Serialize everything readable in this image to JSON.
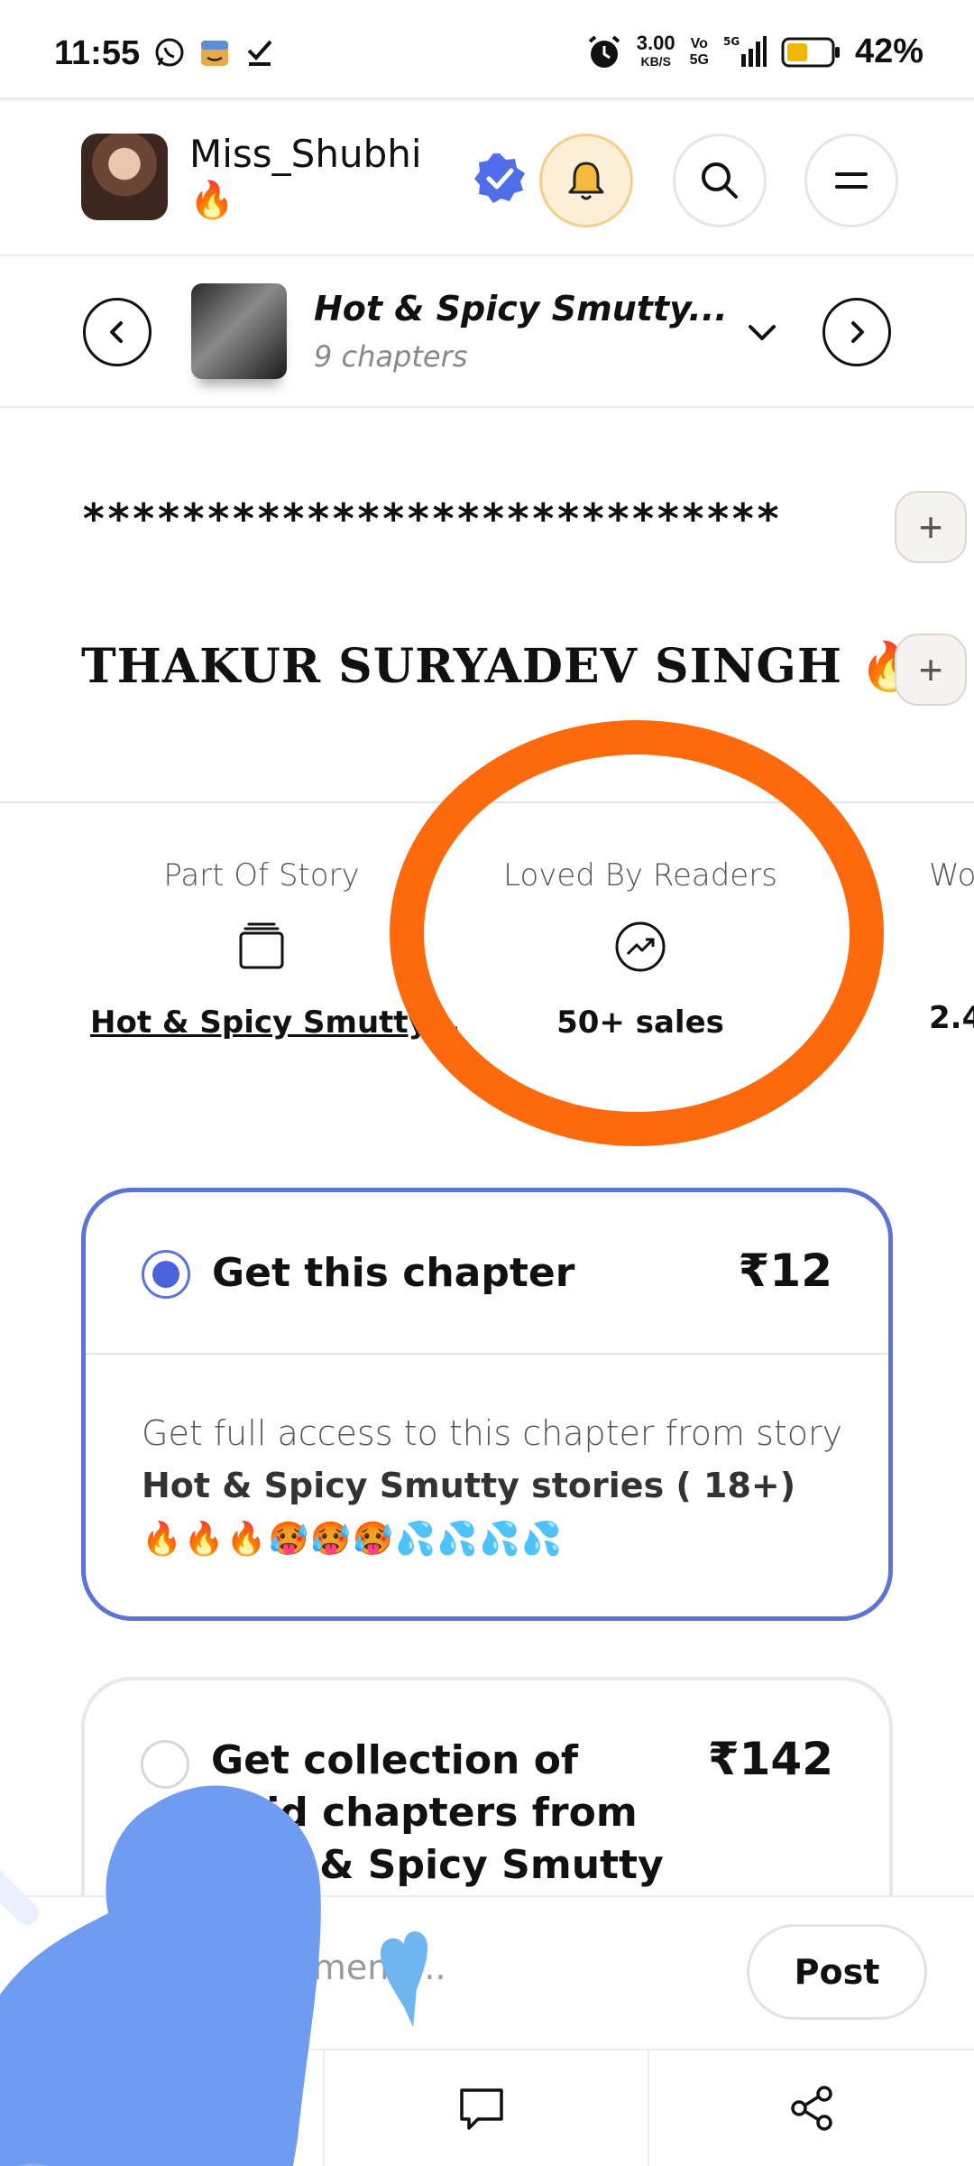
{
  "status_bar": {
    "time": "11:55",
    "net_speed": "3.00",
    "net_unit": "KB/S",
    "volte_top": "Vo",
    "volte_bottom": "5G",
    "network": "5G",
    "battery": "42%",
    "notification_icons": [
      "whatsapp-icon",
      "amazon-icon",
      "check-icon"
    ]
  },
  "header": {
    "username": "Miss_Shubhi",
    "user_badge": "🔥",
    "icons": [
      "verified-icon",
      "bell-icon",
      "search-icon",
      "menu-icon"
    ],
    "bell_bg_color": "#fcefd8",
    "verified_color": "#4f6ee8"
  },
  "story_nav": {
    "title": "Hot & Spicy Smutty...",
    "subtitle": "9 chapters"
  },
  "content": {
    "stars_line": "****************************",
    "heading": "THAKUR SURYADEV SINGH 🔥",
    "plus_label": "+"
  },
  "stats": [
    {
      "label": "Part Of Story",
      "value": "Hot & Spicy Smutty...",
      "icon": "stack-icon"
    },
    {
      "label": "Loved By Readers",
      "value": "50+ sales",
      "icon": "trending-icon"
    },
    {
      "label": "Wo",
      "value": "2.4",
      "icon": "none"
    }
  ],
  "annotation_color": "#fd6a0e",
  "options": {
    "chapter": {
      "title": "Get this chapter",
      "price": "₹12",
      "desc_prefix": "Get full access to this chapter from story ",
      "desc_bold": "Hot & Spicy Smutty stories ( 18+)",
      "emojis": "🔥🔥🔥🥵🥵🥵💦💦💦💦",
      "accent": "#5b74d8"
    },
    "collection": {
      "title": "Get collection of paid chapters from ‘Hot & Spicy Smutty stories ...",
      "price": "₹142"
    }
  },
  "comment": {
    "placeholder": "Comment ...",
    "post_label": "Post"
  },
  "bottom_bar": {
    "icons": [
      "comment-icon",
      "share-icon"
    ]
  },
  "sticker_color": "#6f9bf0"
}
